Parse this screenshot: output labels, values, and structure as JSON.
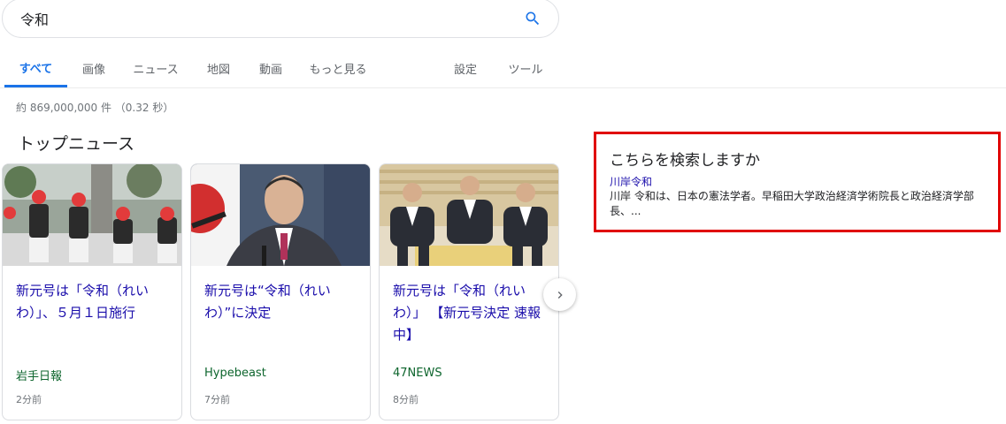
{
  "search": {
    "query": "令和"
  },
  "tabs": [
    {
      "label": "すべて",
      "active": true
    },
    {
      "label": "画像"
    },
    {
      "label": "ニュース"
    },
    {
      "label": "地図"
    },
    {
      "label": "動画"
    },
    {
      "label": "もっと見る"
    },
    {
      "label": "設定"
    },
    {
      "label": "ツール"
    }
  ],
  "result_stats": "約 869,000,000 件 （0.32 秒）",
  "top_news": {
    "title": "トップニュース",
    "cards": [
      {
        "title": "新元号は「令和（れいわ）」、５月１日施行",
        "source": "岩手日報",
        "time": "2分前"
      },
      {
        "title": "新元号は“令和（れいわ）”に決定",
        "source": "Hypebeast",
        "time": "7分前"
      },
      {
        "title": "新元号は「令和（れいわ）」 【新元号決定 速報中】",
        "source": "47NEWS",
        "time": "8分前"
      }
    ]
  },
  "did_you_mean": {
    "heading": "こちらを検索しますか",
    "link": "川岸令和",
    "snippet": "川岸 令和は、日本の憲法学者。早稲田大学政治経済学術院長と政治経済学部長、..."
  },
  "colors": {
    "accent": "#1a73e8",
    "link": "#1a0dab",
    "source": "#0d652d",
    "highlight_border": "#e00000"
  },
  "icons": {
    "search": "search-icon",
    "next": "chevron-right-icon"
  }
}
